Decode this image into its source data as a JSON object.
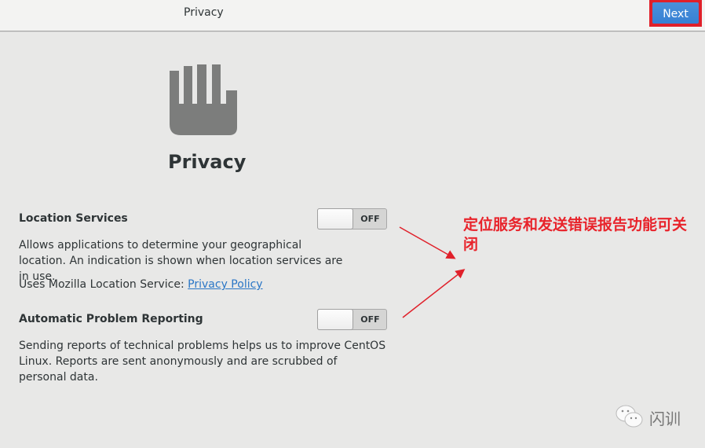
{
  "header": {
    "title": "Privacy",
    "next_label": "Next"
  },
  "page": {
    "icon": "hand-stop-icon",
    "title": "Privacy"
  },
  "settings": [
    {
      "title": "Location Services",
      "state": "OFF",
      "enabled": false,
      "description": "Allows applications to determine your geographical location. An indication is shown when location services are in use.",
      "extra_prefix": "Uses Mozilla Location Service: ",
      "extra_link": "Privacy Policy"
    },
    {
      "title": "Automatic Problem Reporting",
      "state": "OFF",
      "enabled": false,
      "description": "Sending reports of technical problems helps us to improve CentOS Linux. Reports are sent anonymously and are scrubbed of personal data."
    }
  ],
  "annotation": {
    "text": "定位服务和发送错误报告功能可关闭",
    "color": "#e8232b"
  },
  "watermark": {
    "icon": "wechat-icon",
    "text": "闪训"
  },
  "colors": {
    "accent": "#3680d4",
    "highlight_border": "#e0202a",
    "link": "#2a76c6"
  }
}
